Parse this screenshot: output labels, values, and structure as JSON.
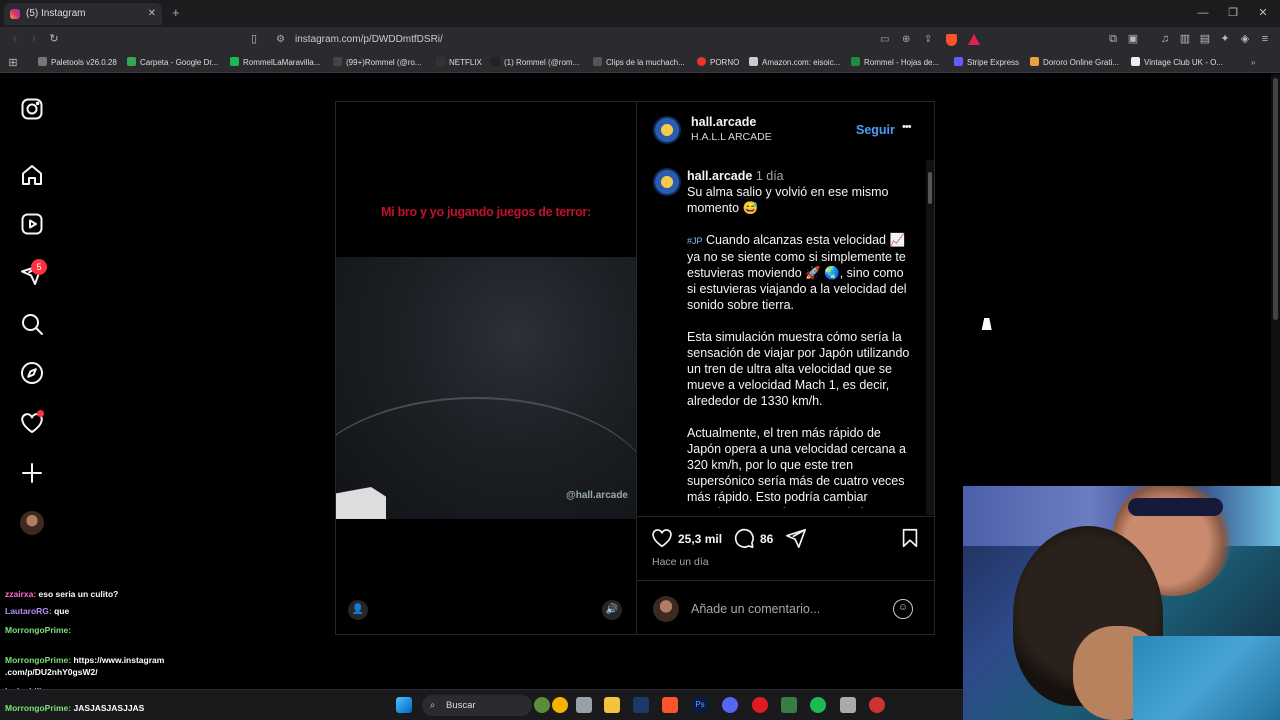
{
  "browser": {
    "tab_title": "(5) Instagram",
    "url": "instagram.com/p/DWDDmtfDSRi/",
    "new_tab_symbol": "+",
    "window_controls": [
      "—",
      "❐",
      "✕"
    ]
  },
  "bookmarks": [
    {
      "label": "Paletools v26.0.28",
      "color": "#777"
    },
    {
      "label": "Carpeta - Google Dr...",
      "color": "#34a853"
    },
    {
      "label": "RommelLaMaravilla...",
      "color": "#1db954"
    },
    {
      "label": "(99+)Rommel (@ro...",
      "color": "#444"
    },
    {
      "label": "NETFLIX",
      "color": "#333"
    },
    {
      "label": "(1) Rommel (@rom...",
      "color": "#222"
    },
    {
      "label": "Clips de la muchach...",
      "color": "#555"
    },
    {
      "label": "PORNO",
      "color": "#e33"
    },
    {
      "label": "Amazon.com: eisoic...",
      "color": "#ccc"
    },
    {
      "label": "Rommel - Hojas de...",
      "color": "#1e8e3e"
    },
    {
      "label": "Stripe Express",
      "color": "#635bff"
    },
    {
      "label": "Dororo Online Grati...",
      "color": "#e8a33c"
    },
    {
      "label": "Vintage Club UK - O...",
      "color": "#eee"
    }
  ],
  "sidebar": {
    "notification_count": "5"
  },
  "post": {
    "username": "hall.arcade",
    "subtitle": "H.A.L.L ARCADE",
    "follow_label": "Seguir",
    "more_label": "•••",
    "video_overlay_text": "Mi bro y yo jugando juegos de terror:",
    "video_watermark": "@hall.arcade",
    "caption_user": "hall.arcade",
    "caption_time": "1 día",
    "caption_p1": "Su alma salio y volvió en ese mismo momento 😅",
    "caption_p2_tag": "#JP",
    "caption_p2": " Cuando alcanzas esta velocidad 📈 ya no se siente como si simplemente te estuvieras moviendo 🚀 🌏, sino como si estuvieras viajando a la velocidad del sonido sobre tierra.",
    "caption_p3": "Esta simulación muestra cómo sería la sensación de viajar por Japón utilizando un tren de ultra alta velocidad que se mueve a velocidad Mach 1, es decir, alrededor de 1330 km/h.",
    "caption_p4": "Actualmente, el tren más rápido de Japón opera a una velocidad cercana a 320 km/h, por lo que este tren supersónico sería más de cuatro veces más rápido. Esto podría cambiar completamente el concepto de los viajes",
    "likes": "25,3 mil",
    "comments": "86",
    "posted_ago": "Hace un día",
    "comment_placeholder": "Añade un comentario..."
  },
  "chat": [
    {
      "user": "zzairxa:",
      "msg": " eso seria un culito?",
      "color": "#ff6ad5"
    },
    {
      "user": "LautaroRG:",
      "msg": " que",
      "color": "#b28cff"
    },
    {
      "user": "MorrongoPrime:",
      "msg": "",
      "color": "#7be07b"
    },
    {
      "user": "MorrongoPrime:",
      "msg": " https://www.instagram",
      "color": "#7be07b"
    },
    {
      "user": "",
      "msg": ".com/p/DU2nhY0gsW2/",
      "color": "#7be07b"
    },
    {
      "user": "lv_luchiii:",
      "msg": "",
      "color": "#9ad0ff"
    },
    {
      "user": "MorrongoPrime:",
      "msg": " JASJASJASJJAS",
      "color": "#7be07b"
    }
  ],
  "taskbar": {
    "search_label": "Buscar"
  }
}
